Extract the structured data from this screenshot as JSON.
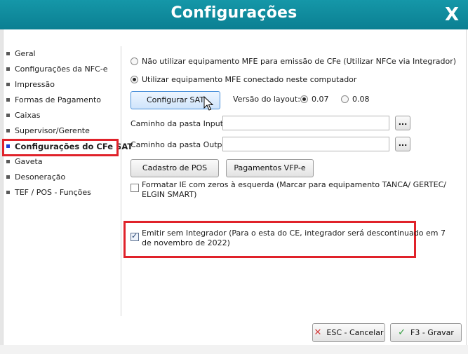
{
  "window": {
    "title": "Configurações",
    "close_label": "X"
  },
  "sidebar": {
    "items": [
      {
        "label": "Geral"
      },
      {
        "label": "Configurações da NFC-e"
      },
      {
        "label": "Impressão"
      },
      {
        "label": "Formas de Pagamento"
      },
      {
        "label": "Caixas"
      },
      {
        "label": "Supervisor/Gerente"
      },
      {
        "label": "Configurações do CFe SAT",
        "active": true
      },
      {
        "label": "Gaveta"
      },
      {
        "label": "Desoneração"
      },
      {
        "label": "TEF / POS - Funções"
      }
    ]
  },
  "main": {
    "radio_no_mfe": {
      "label": "Não utilizar equipamento MFE para emissão de CFe (Utilizar NFCe via Integrador)",
      "selected": false
    },
    "radio_mfe": {
      "label": "Utilizar equipamento MFE conectado neste computador",
      "selected": true
    },
    "configure_sat_label": "Configurar SAT",
    "layout_version": {
      "label": "Versão do layout:",
      "options": [
        {
          "label": "0.07",
          "selected": true
        },
        {
          "label": "0.08",
          "selected": false
        }
      ]
    },
    "input_path": {
      "label": "Caminho da pasta Input:",
      "value": "",
      "browse_label": "..."
    },
    "output_path": {
      "label": "Caminho da pasta Output:",
      "value": "",
      "browse_label": "..."
    },
    "pos_register_label": "Cadastro de POS",
    "vfp_payments_label": "Pagamentos VFP-e",
    "format_ie": {
      "line1": "Formatar IE com zeros à esquerda (Marcar para equipamento TANCA/ GERTEC/",
      "line2": "ELGIN SMART)",
      "checked": false
    },
    "emit_without_integrator": {
      "line1": "Emitir sem Integrador (Para o esta do CE, integrador será descontinuado em  7",
      "line2": "de novembro de 2022)",
      "checked": true
    }
  },
  "footer": {
    "cancel_label": "ESC - Cancelar",
    "save_label": "F3 - Gravar"
  },
  "colors": {
    "titlebar": "#0b7f92",
    "highlight": "#e0222a",
    "active_bullet": "#1a3fd4"
  }
}
